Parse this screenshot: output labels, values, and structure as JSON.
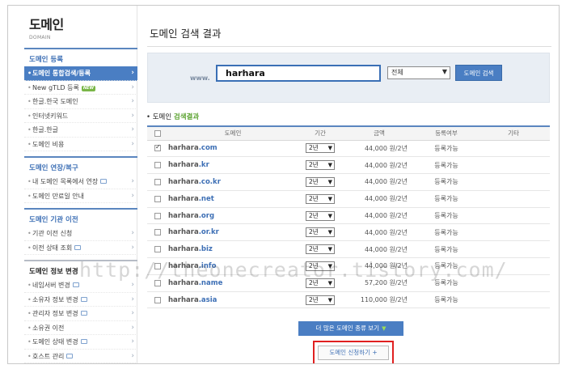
{
  "logo": {
    "title": "도메인",
    "subtitle": "DOMAIN"
  },
  "sidebar": {
    "groups": [
      {
        "title": "도메인 등록",
        "items": [
          {
            "label": "도메인 통합검색/등록",
            "active": true
          },
          {
            "label": "New gTLD 등록",
            "badge": "NEW"
          },
          {
            "label": "한글.한국 도메인"
          },
          {
            "label": "인터넷키워드"
          },
          {
            "label": "한글.한글"
          },
          {
            "label": "도메인 비용"
          }
        ]
      },
      {
        "title": "도메인 연장/복구",
        "items": [
          {
            "label": "내 도메인 목록에서 연장",
            "ext": true
          },
          {
            "label": "도메인 만료일 안내"
          }
        ]
      },
      {
        "title": "도메인 기관 이전",
        "items": [
          {
            "label": "기관 이전 신청"
          },
          {
            "label": "이전 상태 조회",
            "ext": true
          }
        ]
      },
      {
        "title": "도메인 정보 변경",
        "items": [
          {
            "label": "네임서버 변경",
            "ext": true
          },
          {
            "label": "소유자 정보 변경",
            "ext": true
          },
          {
            "label": "관리자 정보 변경",
            "ext": true
          },
          {
            "label": "소유권 이전"
          },
          {
            "label": "도메인 상태 변경",
            "ext": true
          },
          {
            "label": "호스트 관리",
            "ext": true
          }
        ]
      }
    ]
  },
  "main": {
    "title": "도메인 검색 결과",
    "search": {
      "www_label": "www.",
      "value": "harhara",
      "tld_select": "전체",
      "button": "도메인 검색"
    },
    "results": {
      "title_prefix": "도메인",
      "title_highlight": "검색결과",
      "headers": {
        "domain": "도메인",
        "period": "기간",
        "price": "금액",
        "status": "등록여부",
        "etc": "기타"
      },
      "rows": [
        {
          "name": "harhara",
          "tld": ".com",
          "checked": true,
          "period": "2년",
          "price": "44,000 원/2년",
          "status": "등록가능"
        },
        {
          "name": "harhara",
          "tld": ".kr",
          "checked": false,
          "period": "2년",
          "price": "44,000 원/2년",
          "status": "등록가능"
        },
        {
          "name": "harhara",
          "tld": ".co.kr",
          "checked": false,
          "period": "2년",
          "price": "44,000 원/2년",
          "status": "등록가능"
        },
        {
          "name": "harhara",
          "tld": ".net",
          "checked": false,
          "period": "2년",
          "price": "44,000 원/2년",
          "status": "등록가능"
        },
        {
          "name": "harhara",
          "tld": ".org",
          "checked": false,
          "period": "2년",
          "price": "44,000 원/2년",
          "status": "등록가능"
        },
        {
          "name": "harhara",
          "tld": ".or.kr",
          "checked": false,
          "period": "2년",
          "price": "44,000 원/2년",
          "status": "등록가능"
        },
        {
          "name": "harhara",
          "tld": ".biz",
          "checked": false,
          "period": "2년",
          "price": "44,000 원/2년",
          "status": "등록가능"
        },
        {
          "name": "harhara",
          "tld": ".info",
          "checked": false,
          "period": "2년",
          "price": "44,000 원/2년",
          "status": "등록가능"
        },
        {
          "name": "harhara",
          "tld": ".name",
          "checked": false,
          "period": "2년",
          "price": "57,200 원/2년",
          "status": "등록가능"
        },
        {
          "name": "harhara",
          "tld": ".asia",
          "checked": false,
          "period": "2년",
          "price": "110,000 원/2년",
          "status": "등록가능"
        }
      ]
    },
    "more_button": "더 많은 도메인 종류 보기",
    "apply_button": "도메인 신청하기",
    "apply_button_icon": "+"
  },
  "watermark": "http://theonecreator.tistory.com/",
  "colors": {
    "accent": "#4a7ec3",
    "available": "#5aa22f",
    "highlight_box": "#e02020"
  }
}
